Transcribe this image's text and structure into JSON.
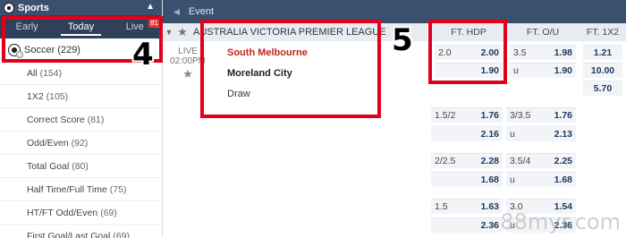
{
  "left_panel": {
    "header": "Sports",
    "tabs": [
      {
        "label": "Early"
      },
      {
        "label": "Today"
      },
      {
        "label": "Live",
        "badge": "81"
      }
    ],
    "selected_sport": "Soccer (229)",
    "menu": [
      {
        "label": "All",
        "count": "(154)"
      },
      {
        "label": "1X2",
        "count": "(105)"
      },
      {
        "label": "Correct Score",
        "count": "(81)"
      },
      {
        "label": "Odd/Even",
        "count": "(92)"
      },
      {
        "label": "Total Goal",
        "count": "(80)"
      },
      {
        "label": "Half Time/Full Time",
        "count": "(75)"
      },
      {
        "label": "HT/FT Odd/Even",
        "count": "(69)"
      },
      {
        "label": "First Goal/Last Goal",
        "count": "(69)"
      }
    ]
  },
  "annotations": {
    "label_4": "4",
    "label_5": "5"
  },
  "main": {
    "event_header": "Event",
    "league": "AUSTRALIA VICTORIA PREMIER LEAGUE",
    "columns": {
      "hdp": "FT. HDP",
      "ou": "FT. O/U",
      "x12": "FT. 1X2"
    },
    "match": {
      "status": "LIVE",
      "time": "02:00PM",
      "home": "South Melbourne",
      "away": "Moreland City",
      "draw": "Draw"
    },
    "odds_rows": [
      {
        "hdp_line": "2.0",
        "hdp_home": "2.00",
        "hdp_away": "1.90",
        "ou_line": "3.5",
        "ou_over": "1.98",
        "ou_u": "u",
        "ou_under": "1.90",
        "x1": "1.21",
        "xx": "10.00",
        "x2": "5.70"
      },
      {
        "hdp_line": "1.5/2",
        "hdp_home": "1.76",
        "hdp_away": "2.16",
        "ou_line": "3/3.5",
        "ou_over": "1.76",
        "ou_u": "u",
        "ou_under": "2.13"
      },
      {
        "hdp_line": "2/2.5",
        "hdp_home": "2.28",
        "hdp_away": "1.68",
        "ou_line": "3.5/4",
        "ou_over": "2.25",
        "ou_u": "u",
        "ou_under": "1.68"
      },
      {
        "hdp_line": "1.5",
        "hdp_home": "1.63",
        "hdp_away": "2.36",
        "ou_line": "3.0",
        "ou_over": "1.54",
        "ou_u": "u",
        "ou_under": "2.36"
      }
    ]
  },
  "watermark": "88myr.com",
  "colors": {
    "header_bg": "#39506f",
    "tab_bg": "#2e405a",
    "annotation_red": "#e0001b",
    "home_team": "#c0241f",
    "odds_value": "#1f3a62"
  }
}
